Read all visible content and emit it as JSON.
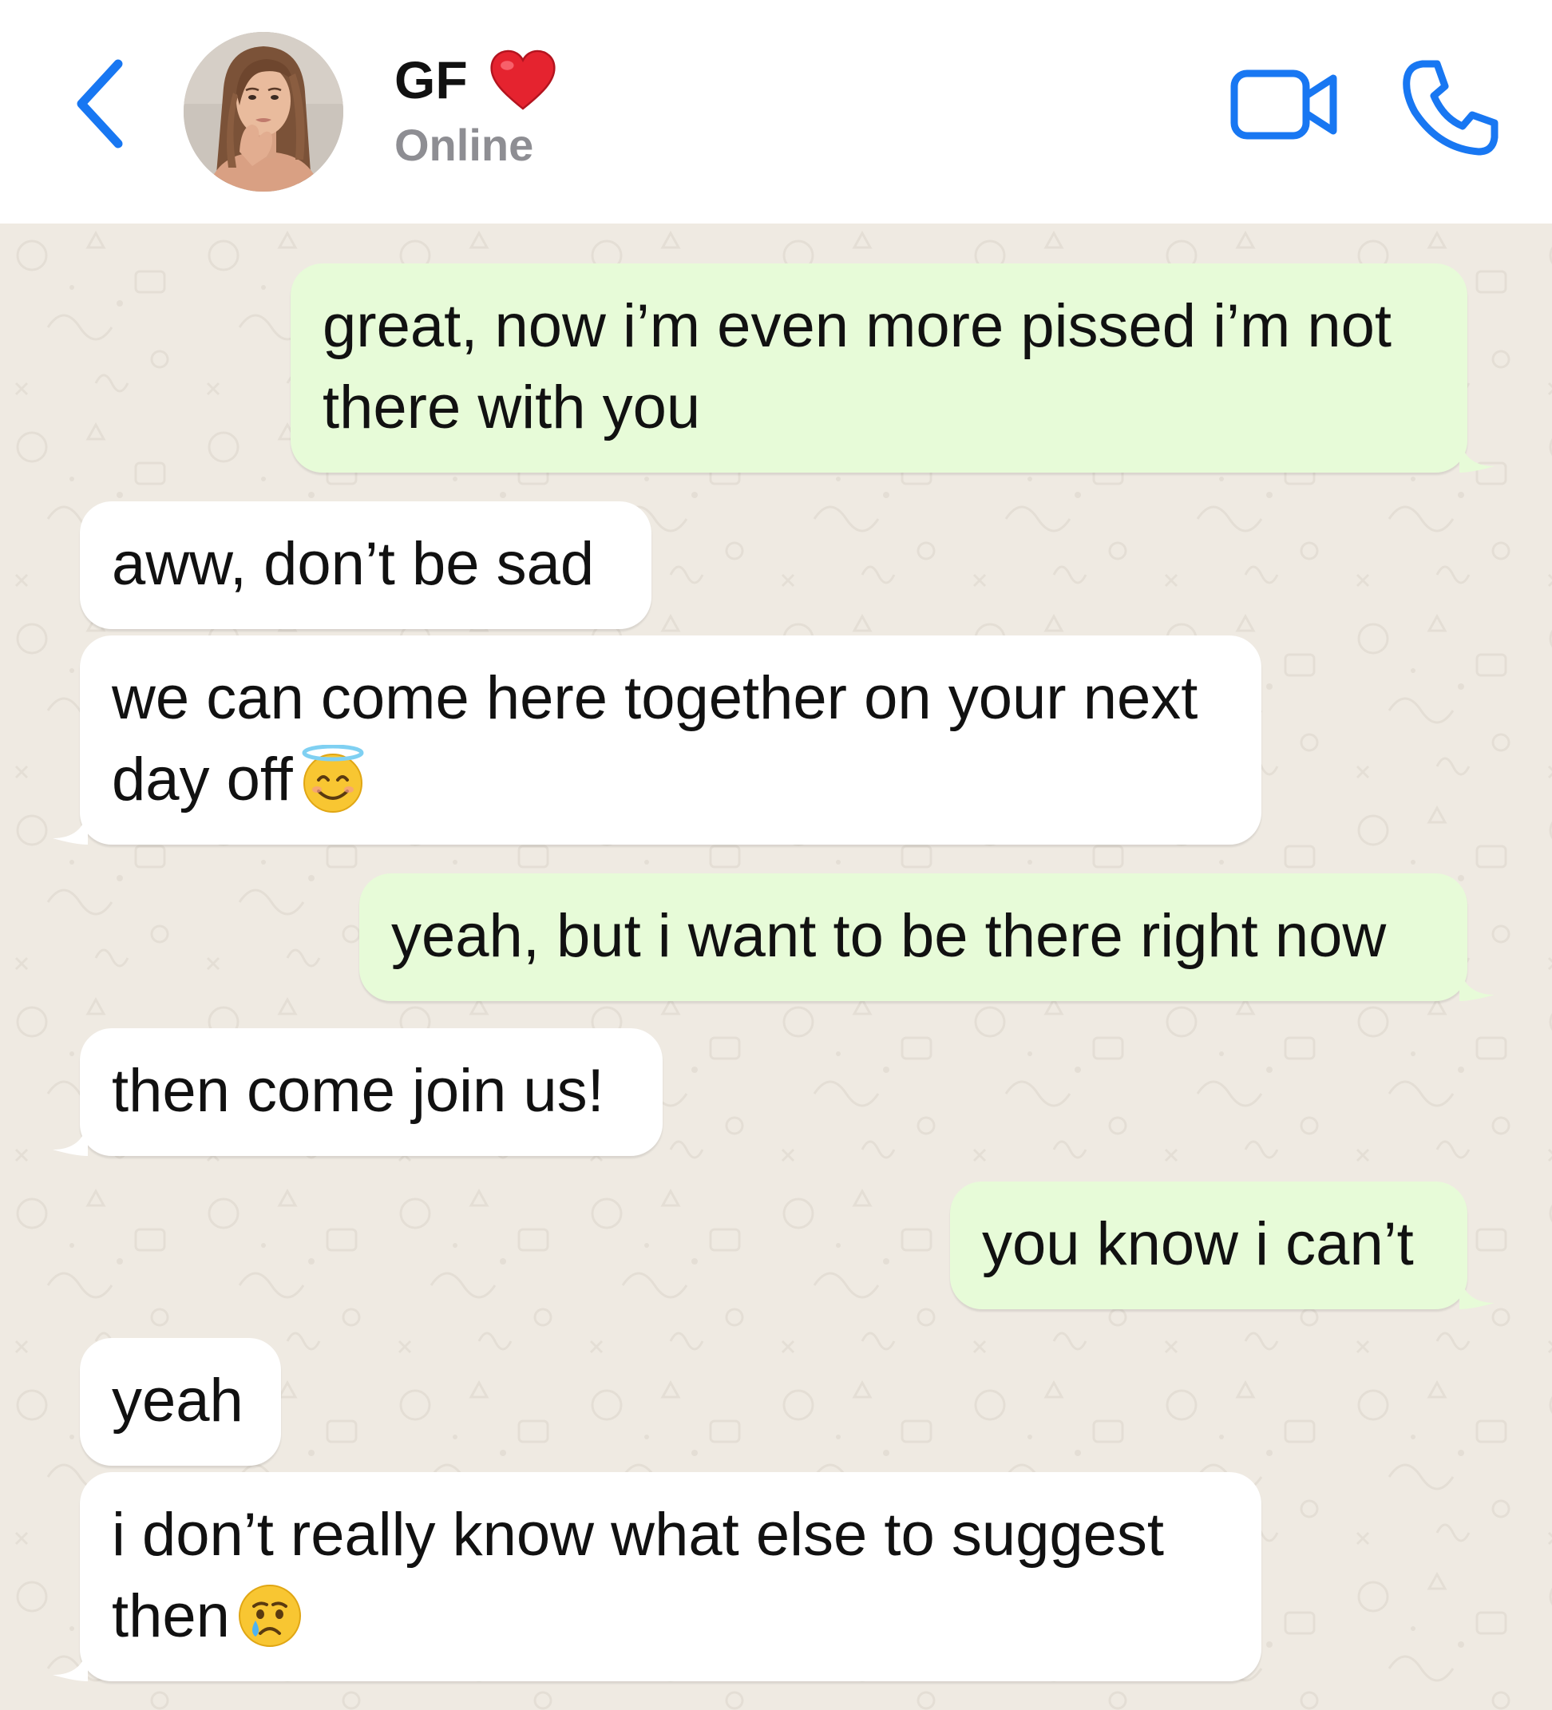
{
  "header": {
    "contact_name": "GF",
    "contact_status": "Online",
    "icons": {
      "back": "chevron-left-icon",
      "heart": "red-heart-icon",
      "video": "video-camera-icon",
      "call": "phone-icon"
    },
    "accent_color": "#1877f2"
  },
  "messages": [
    {
      "direction": "outgoing",
      "text": "great, now i’m even more pissed i’m not there with you"
    },
    {
      "direction": "incoming",
      "text": "aww, don’t be sad"
    },
    {
      "direction": "incoming",
      "text": "we can come here together on your next day off",
      "emoji": "smiling-face-with-halo"
    },
    {
      "direction": "outgoing",
      "text": "yeah, but i want to be there right now"
    },
    {
      "direction": "incoming",
      "text": "then come join us!"
    },
    {
      "direction": "outgoing",
      "text": "you know i can’t"
    },
    {
      "direction": "incoming",
      "text": "yeah"
    },
    {
      "direction": "incoming",
      "text": "i don’t really know what else to suggest then",
      "emoji": "crying-face"
    }
  ],
  "colors": {
    "outgoing_bubble": "#e7fbd8",
    "incoming_bubble": "#ffffff",
    "chat_background": "#efeae2",
    "status_text": "#8e8e93"
  }
}
